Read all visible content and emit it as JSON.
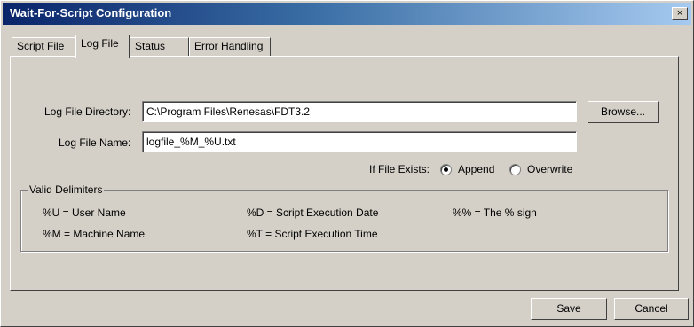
{
  "window": {
    "title": "Wait-For-Script Configuration",
    "close_symbol": "×"
  },
  "tabs": [
    {
      "label": "Script File",
      "active": false
    },
    {
      "label": "Log File",
      "active": true
    },
    {
      "label": "Status File",
      "active": false
    },
    {
      "label": "Error Handling",
      "active": false
    }
  ],
  "log_file": {
    "directory_label": "Log File Directory:",
    "directory_value": "C:\\Program Files\\Renesas\\FDT3.2",
    "browse_label": "Browse...",
    "name_label": "Log File Name:",
    "name_value": "logfile_%M_%U.txt",
    "if_exists_label": "If File Exists:",
    "options": [
      {
        "label": "Append",
        "selected": true
      },
      {
        "label": "Overwrite",
        "selected": false
      }
    ]
  },
  "delimiters": {
    "group_label": "Valid Delimiters",
    "items": [
      "%U = User Name",
      "%M = Machine Name",
      "%D = Script Execution Date",
      "%T = Script Execution Time",
      "%% = The % sign"
    ]
  },
  "footer": {
    "save_label": "Save",
    "cancel_label": "Cancel"
  },
  "colors": {
    "titlebar_start": "#0a246a",
    "titlebar_end": "#a6caf0",
    "face": "#d4d0c8"
  }
}
